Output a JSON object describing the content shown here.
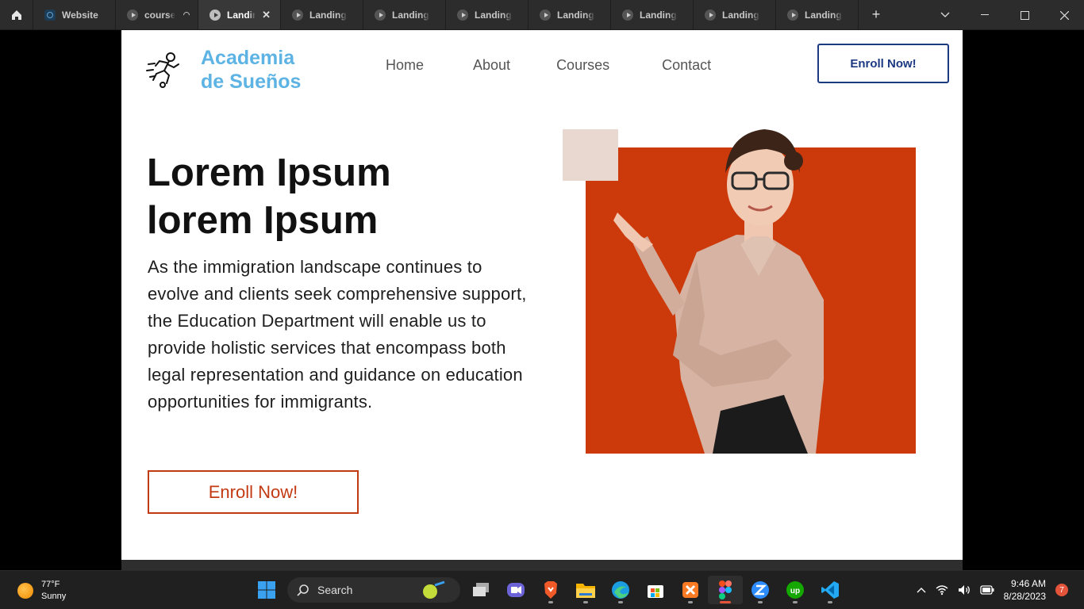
{
  "tabs": [
    {
      "label": "Website",
      "kind": "file",
      "active": false
    },
    {
      "label": "course",
      "kind": "proto",
      "active": false,
      "loading": true
    },
    {
      "label": "Landing",
      "kind": "proto",
      "active": true
    },
    {
      "label": "Landing P",
      "kind": "proto",
      "active": false
    },
    {
      "label": "Landing P",
      "kind": "proto",
      "active": false
    },
    {
      "label": "Landing P",
      "kind": "proto",
      "active": false
    },
    {
      "label": "Landing P",
      "kind": "proto",
      "active": false
    },
    {
      "label": "Landing P",
      "kind": "proto",
      "active": false
    },
    {
      "label": "Landing P",
      "kind": "proto",
      "active": false
    },
    {
      "label": "Landing P",
      "kind": "proto",
      "active": false
    }
  ],
  "site": {
    "brand": "Academia\nde Sueños",
    "nav": [
      "Home",
      "About",
      "Courses",
      "Contact"
    ],
    "enroll_top": "Enroll Now!",
    "hero_title": "Lorem Ipsum\nlorem Ipsum",
    "hero_body": "As the immigration landscape continues to evolve and clients seek comprehensive support, the Education Department will enable us to provide holistic services that encompass both legal representation and guidance on education opportunities for immigrants.",
    "enroll_main": "Enroll Now!",
    "colors": {
      "brand": "#5db3e3",
      "nav_button": "#1b3a82",
      "accent": "#cc3a0c",
      "square": "#e8d8cf"
    }
  },
  "taskbar": {
    "weather_temp": "77°F",
    "weather_desc": "Sunny",
    "search_label": "Search",
    "time": "9:46 AM",
    "date": "8/28/2023",
    "notifications": "7"
  }
}
